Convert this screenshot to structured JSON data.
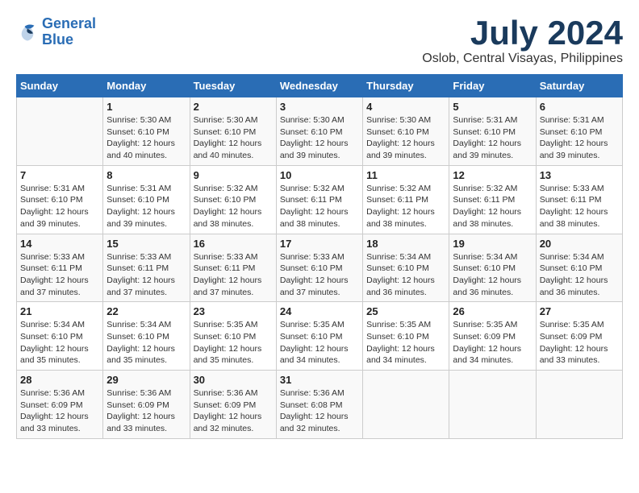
{
  "logo": {
    "line1": "General",
    "line2": "Blue"
  },
  "title": "July 2024",
  "location": "Oslob, Central Visayas, Philippines",
  "days_header": [
    "Sunday",
    "Monday",
    "Tuesday",
    "Wednesday",
    "Thursday",
    "Friday",
    "Saturday"
  ],
  "weeks": [
    [
      {
        "day": "",
        "info": ""
      },
      {
        "day": "1",
        "info": "Sunrise: 5:30 AM\nSunset: 6:10 PM\nDaylight: 12 hours\nand 40 minutes."
      },
      {
        "day": "2",
        "info": "Sunrise: 5:30 AM\nSunset: 6:10 PM\nDaylight: 12 hours\nand 40 minutes."
      },
      {
        "day": "3",
        "info": "Sunrise: 5:30 AM\nSunset: 6:10 PM\nDaylight: 12 hours\nand 39 minutes."
      },
      {
        "day": "4",
        "info": "Sunrise: 5:30 AM\nSunset: 6:10 PM\nDaylight: 12 hours\nand 39 minutes."
      },
      {
        "day": "5",
        "info": "Sunrise: 5:31 AM\nSunset: 6:10 PM\nDaylight: 12 hours\nand 39 minutes."
      },
      {
        "day": "6",
        "info": "Sunrise: 5:31 AM\nSunset: 6:10 PM\nDaylight: 12 hours\nand 39 minutes."
      }
    ],
    [
      {
        "day": "7",
        "info": "Sunrise: 5:31 AM\nSunset: 6:10 PM\nDaylight: 12 hours\nand 39 minutes."
      },
      {
        "day": "8",
        "info": "Sunrise: 5:31 AM\nSunset: 6:10 PM\nDaylight: 12 hours\nand 39 minutes."
      },
      {
        "day": "9",
        "info": "Sunrise: 5:32 AM\nSunset: 6:10 PM\nDaylight: 12 hours\nand 38 minutes."
      },
      {
        "day": "10",
        "info": "Sunrise: 5:32 AM\nSunset: 6:11 PM\nDaylight: 12 hours\nand 38 minutes."
      },
      {
        "day": "11",
        "info": "Sunrise: 5:32 AM\nSunset: 6:11 PM\nDaylight: 12 hours\nand 38 minutes."
      },
      {
        "day": "12",
        "info": "Sunrise: 5:32 AM\nSunset: 6:11 PM\nDaylight: 12 hours\nand 38 minutes."
      },
      {
        "day": "13",
        "info": "Sunrise: 5:33 AM\nSunset: 6:11 PM\nDaylight: 12 hours\nand 38 minutes."
      }
    ],
    [
      {
        "day": "14",
        "info": "Sunrise: 5:33 AM\nSunset: 6:11 PM\nDaylight: 12 hours\nand 37 minutes."
      },
      {
        "day": "15",
        "info": "Sunrise: 5:33 AM\nSunset: 6:11 PM\nDaylight: 12 hours\nand 37 minutes."
      },
      {
        "day": "16",
        "info": "Sunrise: 5:33 AM\nSunset: 6:11 PM\nDaylight: 12 hours\nand 37 minutes."
      },
      {
        "day": "17",
        "info": "Sunrise: 5:33 AM\nSunset: 6:10 PM\nDaylight: 12 hours\nand 37 minutes."
      },
      {
        "day": "18",
        "info": "Sunrise: 5:34 AM\nSunset: 6:10 PM\nDaylight: 12 hours\nand 36 minutes."
      },
      {
        "day": "19",
        "info": "Sunrise: 5:34 AM\nSunset: 6:10 PM\nDaylight: 12 hours\nand 36 minutes."
      },
      {
        "day": "20",
        "info": "Sunrise: 5:34 AM\nSunset: 6:10 PM\nDaylight: 12 hours\nand 36 minutes."
      }
    ],
    [
      {
        "day": "21",
        "info": "Sunrise: 5:34 AM\nSunset: 6:10 PM\nDaylight: 12 hours\nand 35 minutes."
      },
      {
        "day": "22",
        "info": "Sunrise: 5:34 AM\nSunset: 6:10 PM\nDaylight: 12 hours\nand 35 minutes."
      },
      {
        "day": "23",
        "info": "Sunrise: 5:35 AM\nSunset: 6:10 PM\nDaylight: 12 hours\nand 35 minutes."
      },
      {
        "day": "24",
        "info": "Sunrise: 5:35 AM\nSunset: 6:10 PM\nDaylight: 12 hours\nand 34 minutes."
      },
      {
        "day": "25",
        "info": "Sunrise: 5:35 AM\nSunset: 6:10 PM\nDaylight: 12 hours\nand 34 minutes."
      },
      {
        "day": "26",
        "info": "Sunrise: 5:35 AM\nSunset: 6:09 PM\nDaylight: 12 hours\nand 34 minutes."
      },
      {
        "day": "27",
        "info": "Sunrise: 5:35 AM\nSunset: 6:09 PM\nDaylight: 12 hours\nand 33 minutes."
      }
    ],
    [
      {
        "day": "28",
        "info": "Sunrise: 5:36 AM\nSunset: 6:09 PM\nDaylight: 12 hours\nand 33 minutes."
      },
      {
        "day": "29",
        "info": "Sunrise: 5:36 AM\nSunset: 6:09 PM\nDaylight: 12 hours\nand 33 minutes."
      },
      {
        "day": "30",
        "info": "Sunrise: 5:36 AM\nSunset: 6:09 PM\nDaylight: 12 hours\nand 32 minutes."
      },
      {
        "day": "31",
        "info": "Sunrise: 5:36 AM\nSunset: 6:08 PM\nDaylight: 12 hours\nand 32 minutes."
      },
      {
        "day": "",
        "info": ""
      },
      {
        "day": "",
        "info": ""
      },
      {
        "day": "",
        "info": ""
      }
    ]
  ]
}
